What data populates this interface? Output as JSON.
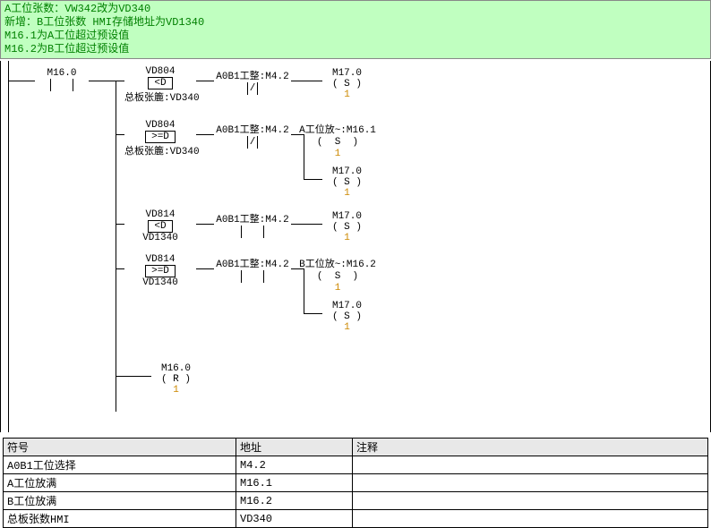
{
  "comments": [
    "A工位张数：VW342改为VD340",
    "新增：B工位张数 HMI存储地址为VD1340",
    "M16.1为A工位超过预设值",
    "M16.2为B工位超过预设值"
  ],
  "contacts": {
    "m160": "M16.0",
    "m42a": "A0B1工整:M4.2",
    "m42b": "A0B1工整:M4.2",
    "m42c": "A0B1工整:M4.2",
    "m42d": "A0B1工整:M4.2",
    "m161": "A工位放~:M16.1",
    "m162": "B工位放~:M16.2",
    "slash": "/"
  },
  "compares": {
    "c1": {
      "top": "VD804",
      "op": "<D",
      "bot": "总板张簏:VD340"
    },
    "c2": {
      "top": "VD804",
      "op": ">=D",
      "bot": "总板张簏:VD340"
    },
    "c3": {
      "top": "VD814",
      "op": "<D",
      "bot": "VD1340"
    },
    "c4": {
      "top": "VD814",
      "op": ">=D",
      "bot": "VD1340"
    }
  },
  "coils": {
    "s1": {
      "lbl": "M17.0",
      "sym": "(  S  )",
      "cnt": "1"
    },
    "s2": {
      "lbl": "",
      "sym": "(  S  )",
      "cnt": "1"
    },
    "s3": {
      "lbl": "M17.0",
      "sym": "(  S  )",
      "cnt": "1"
    },
    "s4": {
      "lbl": "M17.0",
      "sym": "(  S  )",
      "cnt": "1"
    },
    "s5": {
      "lbl": "",
      "sym": "(  S  )",
      "cnt": "1"
    },
    "s6": {
      "lbl": "M17.0",
      "sym": "(  S  )",
      "cnt": "1"
    },
    "r1": {
      "lbl": "M16.0",
      "sym": "(  R  )",
      "cnt": "1"
    }
  },
  "table": {
    "headers": [
      "符号",
      "地址",
      "注释"
    ],
    "rows": [
      [
        "A0B1工位选择",
        "M4.2",
        ""
      ],
      [
        "A工位放满",
        "M16.1",
        ""
      ],
      [
        "B工位放满",
        "M16.2",
        ""
      ],
      [
        "总板张数HMI",
        "VD340",
        ""
      ]
    ]
  }
}
